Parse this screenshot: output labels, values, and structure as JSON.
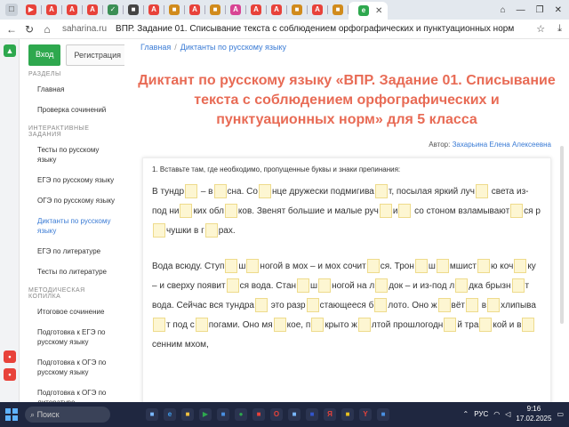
{
  "browser": {
    "host": "saharina.ru",
    "tab_title": "ВПР. Задание 01. Списывание текста с соблюдением орфографических и пунктуационных норм",
    "tab_icons": [
      {
        "letter": "▶",
        "color": "#e8423a"
      },
      {
        "letter": "A",
        "color": "#e8423a"
      },
      {
        "letter": "A",
        "color": "#e8423a"
      },
      {
        "letter": "A",
        "color": "#e8423a"
      },
      {
        "letter": "✓",
        "color": "#3b8f55"
      },
      {
        "letter": "■",
        "color": "#444"
      },
      {
        "letter": "A",
        "color": "#e8423a"
      },
      {
        "letter": "■",
        "color": "#d18b1c"
      },
      {
        "letter": "A",
        "color": "#e8423a"
      },
      {
        "letter": "■",
        "color": "#d18b1c"
      },
      {
        "letter": "A",
        "color": "#d84494"
      },
      {
        "letter": "A",
        "color": "#e8423a"
      },
      {
        "letter": "A",
        "color": "#e8423a"
      },
      {
        "letter": "■",
        "color": "#d18b1c"
      },
      {
        "letter": "A",
        "color": "#e8423a"
      },
      {
        "letter": "■",
        "color": "#d18b1c"
      }
    ]
  },
  "auth": {
    "login": "Вход",
    "register": "Регистрация"
  },
  "sidebar": {
    "section1": "Разделы",
    "items1": [
      "Главная",
      "Проверка сочинений"
    ],
    "section2": "Интерактивные задания",
    "items2": [
      "Тесты по русскому языку",
      "ЕГЭ по русскому языку",
      "ОГЭ по русскому языку",
      "Диктанты по русскому языку",
      "ЕГЭ по литературе",
      "Тесты по литературе"
    ],
    "section3": "Методическая копилка",
    "items3": [
      "Итоговое сочинение",
      "Подготовка к ЕГЭ по русскому языку",
      "Подготовка к ОГЭ по русскому языку",
      "Подготовка к ОГЭ по литературе"
    ]
  },
  "main": {
    "crumb_home": "Главная",
    "crumb_section": "Диктанты по русскому языку",
    "title": "Диктант по русскому языку «ВПР. Задание 01. Списывание текста с соблюдением орфографических и пунктуационных норм» для 5 класса",
    "author_label": "Автор:",
    "author_name": "Захарьина Елена Алексеевна",
    "task": "1. Вставьте там, где необходимо, пропущенные буквы и знаки препинания:",
    "dictation": [
      [
        "В тундр",
        " – в",
        "сна. Со",
        "нце дружески подмигива",
        "т, посылая яркий луч",
        " света из-под ни",
        "ких обл",
        "ков. Звенят большие и малые руч",
        "и",
        " со стоном взламывают",
        "ся р",
        "чушки в г",
        "рах."
      ],
      [
        "Вода всюду. Ступ",
        "ш",
        "ногой в мох – и мох сочит",
        "ся. Трон",
        "ш",
        "мшист",
        "ю коч",
        "ку – и сверху появит",
        "ся вода. Стан",
        "ш",
        "ногой на л",
        "док – и из-под л",
        "дка брызн",
        "т вода. Сейчас вся тундра",
        " это разр",
        "стающееся б",
        "лото. Оно ж",
        "вёт",
        " в",
        "хлипыва",
        "т под с",
        "погами. Оно мя",
        "кое, п",
        "крыто ж",
        "лтой прошлогодн",
        "й тра",
        "кой и в",
        "сенним мхом,"
      ]
    ]
  },
  "taskbar": {
    "search_placeholder": "Поиск",
    "lang": "РУС",
    "time": "9:16",
    "date": "17.02.2025",
    "apps": [
      {
        "letter": "■",
        "color": "#7ab8ff"
      },
      {
        "letter": "e",
        "color": "#3fa0f0"
      },
      {
        "letter": "■",
        "color": "#f0c040"
      },
      {
        "letter": "▶",
        "color": "#2ea84e"
      },
      {
        "letter": "■",
        "color": "#4a90e2"
      },
      {
        "letter": "●",
        "color": "#2ea84e"
      },
      {
        "letter": "■",
        "color": "#e8423a"
      },
      {
        "letter": "O",
        "color": "#e8423a"
      },
      {
        "letter": "■",
        "color": "#7ab8ff"
      },
      {
        "letter": "■",
        "color": "#3355cc"
      },
      {
        "letter": "Я",
        "color": "#e8423a"
      },
      {
        "letter": "■",
        "color": "#e8c020"
      },
      {
        "letter": "Y",
        "color": "#e8423a"
      },
      {
        "letter": "■",
        "color": "#4a90e2"
      }
    ]
  }
}
